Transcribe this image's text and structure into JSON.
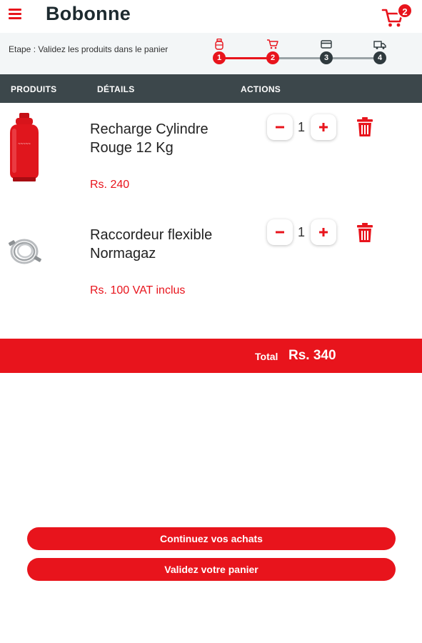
{
  "app": {
    "title": "Bobonne",
    "cart_count": "2"
  },
  "colors": {
    "accent": "#e8141c",
    "dark": "#3c474b",
    "step_inactive": "#2f3a3e"
  },
  "stepper": {
    "text": "Etape : Validez les produits dans le panier",
    "steps": [
      {
        "number": "1",
        "icon": "gas-cylinder-icon",
        "active": true
      },
      {
        "number": "2",
        "icon": "cart-icon",
        "active": true
      },
      {
        "number": "3",
        "icon": "card-icon",
        "active": false
      },
      {
        "number": "4",
        "icon": "truck-icon",
        "active": false
      }
    ]
  },
  "table": {
    "headers": [
      "PRODUITS",
      "DÉTAILS",
      "ACTIONS"
    ]
  },
  "items": [
    {
      "name": "Recharge Cylindre Rouge 12 Kg",
      "price": "Rs. 240",
      "quantity": "1",
      "image": "red-gas-cylinder"
    },
    {
      "name": "Raccordeur flexible Normagaz",
      "price": "Rs. 100 VAT inclus",
      "quantity": "1",
      "image": "flexible-hose"
    }
  ],
  "total": {
    "label": "Total",
    "value": "Rs. 340"
  },
  "buttons": {
    "continue": "Continuez vos achats",
    "validate": "Validez votre panier"
  }
}
